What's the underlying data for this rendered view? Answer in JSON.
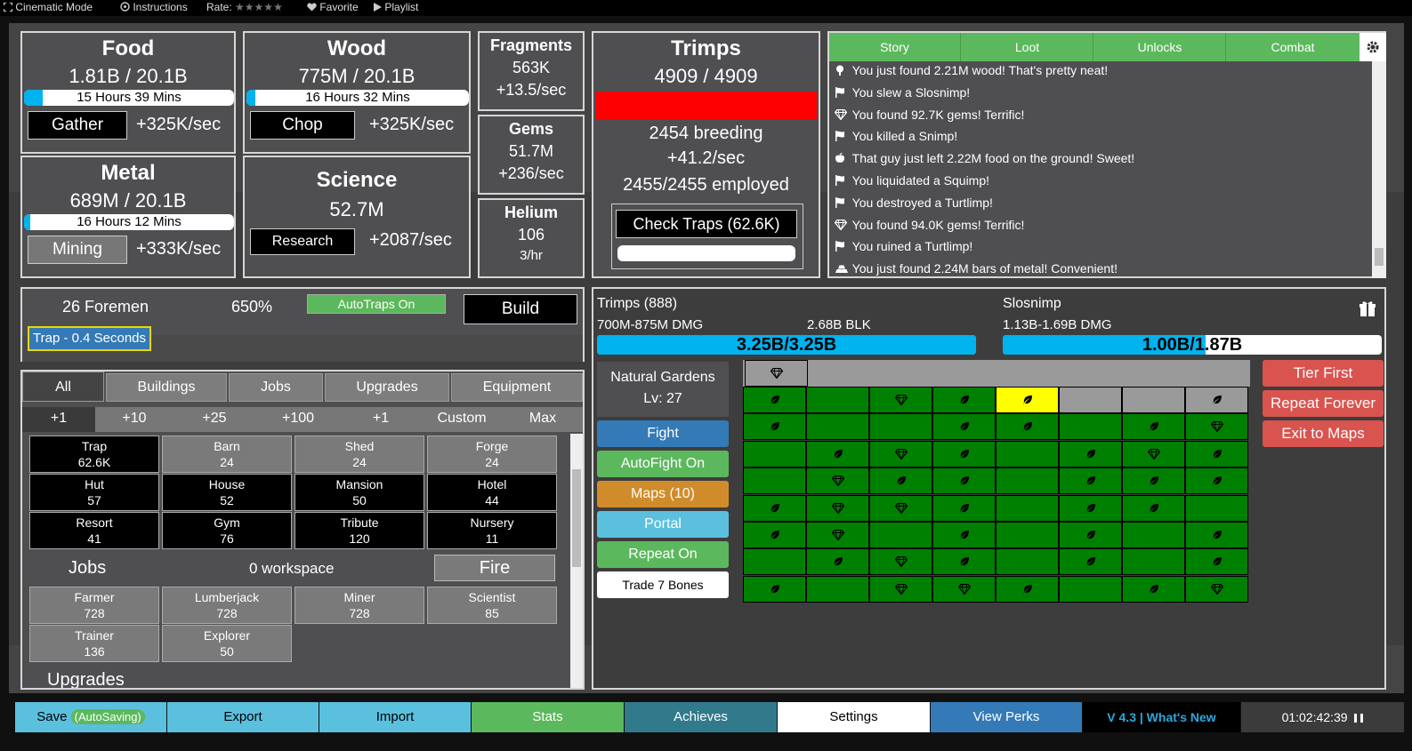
{
  "topbar": {
    "cinematic": "Cinematic Mode",
    "instructions": "Instructions",
    "rate": "Rate:",
    "stars": "★★★★★",
    "favorite": "Favorite",
    "playlist": "Playlist"
  },
  "resources": {
    "food": {
      "title": "Food",
      "amount": "1.81B / 20.1B",
      "time": "15 Hours 39 Mins",
      "button": "Gather",
      "rate": "+325K/sec",
      "fill": 0.09
    },
    "wood": {
      "title": "Wood",
      "amount": "775M / 20.1B",
      "time": "16 Hours 32 Mins",
      "button": "Chop",
      "rate": "+325K/sec",
      "fill": 0.04
    },
    "metal": {
      "title": "Metal",
      "amount": "689M / 20.1B",
      "time": "16 Hours 12 Mins",
      "button": "Mining",
      "rate": "+333K/sec",
      "fill": 0.03
    },
    "science": {
      "title": "Science",
      "amount": "52.7M",
      "button": "Research",
      "rate": "+2087/sec"
    }
  },
  "fragments": {
    "title": "Fragments",
    "amount": "563K",
    "rate": "+13.5/sec"
  },
  "gems": {
    "title": "Gems",
    "amount": "51.7M",
    "rate": "+236/sec"
  },
  "helium": {
    "title": "Helium",
    "amount": "106",
    "rate": "3/hr"
  },
  "trimps": {
    "title": "Trimps",
    "amount": "4909 / 4909",
    "breeding": "2454 breeding",
    "rate": "+41.2/sec",
    "employed": "2455/2455 employed",
    "check_traps": "Check Traps (62.6K)",
    "bar_color": "#ff0000"
  },
  "log": {
    "tabs": [
      "Story",
      "Loot",
      "Unlocks",
      "Combat"
    ],
    "entries": [
      {
        "icon": "tree-icon",
        "text": "You just found 2.21M wood! That's pretty neat!"
      },
      {
        "icon": "flag-icon",
        "text": "You slew a Slosnimp!"
      },
      {
        "icon": "gem-icon",
        "text": "You found 92.7K gems! Terrific!"
      },
      {
        "icon": "flag-icon",
        "text": "You killed a Snimp!"
      },
      {
        "icon": "apple-icon",
        "text": "That guy just left 2.22M food on the ground! Sweet!"
      },
      {
        "icon": "flag-icon",
        "text": "You liquidated a Squimp!"
      },
      {
        "icon": "flag-icon",
        "text": "You destroyed a Turtlimp!"
      },
      {
        "icon": "gem-icon",
        "text": "You found 94.0K gems! Terrific!"
      },
      {
        "icon": "flag-icon",
        "text": "You ruined a Turtlimp!"
      },
      {
        "icon": "metal-bars-icon",
        "text": "You just found 2.24M bars of metal! Convenient!"
      }
    ]
  },
  "build_panel": {
    "foremen": "26 Foremen",
    "percent": "650%",
    "autotraps": "AutoTraps On",
    "build": "Build",
    "trap_queue": "Trap - 0.4 Seconds"
  },
  "buy_tabs": [
    "All",
    "Buildings",
    "Jobs",
    "Upgrades",
    "Equipment"
  ],
  "quantity": [
    "+1",
    "+10",
    "+25",
    "+100",
    "+1",
    "Custom",
    "Max"
  ],
  "buildings": [
    {
      "name": "Trap",
      "count": "62.6K",
      "style": "blk"
    },
    {
      "name": "Barn",
      "count": "24",
      "style": "gry"
    },
    {
      "name": "Shed",
      "count": "24",
      "style": "gry"
    },
    {
      "name": "Forge",
      "count": "24",
      "style": "gry"
    },
    {
      "name": "Hut",
      "count": "57",
      "style": "blk"
    },
    {
      "name": "House",
      "count": "52",
      "style": "blk"
    },
    {
      "name": "Mansion",
      "count": "50",
      "style": "blk"
    },
    {
      "name": "Hotel",
      "count": "44",
      "style": "blk"
    },
    {
      "name": "Resort",
      "count": "41",
      "style": "blk"
    },
    {
      "name": "Gym",
      "count": "76",
      "style": "blk"
    },
    {
      "name": "Tribute",
      "count": "120",
      "style": "blk"
    },
    {
      "name": "Nursery",
      "count": "11",
      "style": "blk"
    }
  ],
  "jobs": {
    "title": "Jobs",
    "workspace": "0 workspace",
    "fire": "Fire",
    "list": [
      {
        "name": "Farmer",
        "count": "728"
      },
      {
        "name": "Lumberjack",
        "count": "728"
      },
      {
        "name": "Miner",
        "count": "728"
      },
      {
        "name": "Scientist",
        "count": "85"
      },
      {
        "name": "Trainer",
        "count": "136"
      },
      {
        "name": "Explorer",
        "count": "50"
      }
    ]
  },
  "upgrades_title": "Upgrades",
  "battle": {
    "trimps_label": "Trimps (888)",
    "trimps_dmg": "700M-875M DMG",
    "trimps_blk": "2.68B BLK",
    "trimps_hp": "3.25B/3.25B",
    "trimps_hp_fraction": 1.0,
    "enemy_name": "Slosnimp",
    "enemy_dmg": "1.13B-1.69B DMG",
    "enemy_hp": "1.00B/1.87B",
    "enemy_hp_fraction": 0.535,
    "hp_color": "#00b2ee"
  },
  "map": {
    "name": "Natural Gardens",
    "level": "Lv: 27",
    "fight": "Fight",
    "autofight": "AutoFight On",
    "maps": "Maps (10)",
    "portal": "Portal",
    "repeat": "Repeat On",
    "trade": "Trade 7 Bones",
    "tier_first": "Tier First",
    "repeat_forever": "Repeat Forever",
    "exit": "Exit to Maps",
    "grid": [
      [
        "leaf",
        "",
        "gem",
        "leaf",
        "leaf-yellow",
        "gray",
        "gray",
        "leaf-gray"
      ],
      [
        "leaf",
        "",
        "",
        "leaf",
        "leaf",
        "",
        "leaf",
        "gem"
      ],
      [
        "",
        "leaf",
        "gem",
        "leaf",
        "",
        "leaf",
        "gem",
        "leaf"
      ],
      [
        "",
        "gem",
        "leaf",
        "leaf",
        "",
        "leaf",
        "leaf",
        "leaf"
      ],
      [
        "leaf",
        "gem",
        "gem",
        "leaf",
        "",
        "leaf",
        "leaf",
        ""
      ],
      [
        "leaf",
        "gem",
        "",
        "leaf",
        "",
        "leaf",
        "",
        "leaf"
      ],
      [
        "",
        "leaf",
        "gem",
        "leaf",
        "",
        "leaf",
        "",
        "leaf"
      ],
      [
        "leaf",
        "",
        "gem",
        "gem",
        "leaf",
        "",
        "leaf",
        "gem"
      ]
    ]
  },
  "footer": {
    "save": "Save",
    "autosaving": "(AutoSaving)",
    "export": "Export",
    "import": "Import",
    "stats": "Stats",
    "achieves": "Achieves",
    "settings": "Settings",
    "perks": "View Perks",
    "version": "V 4.3 | What's New",
    "clock": "01:02:42:39"
  }
}
